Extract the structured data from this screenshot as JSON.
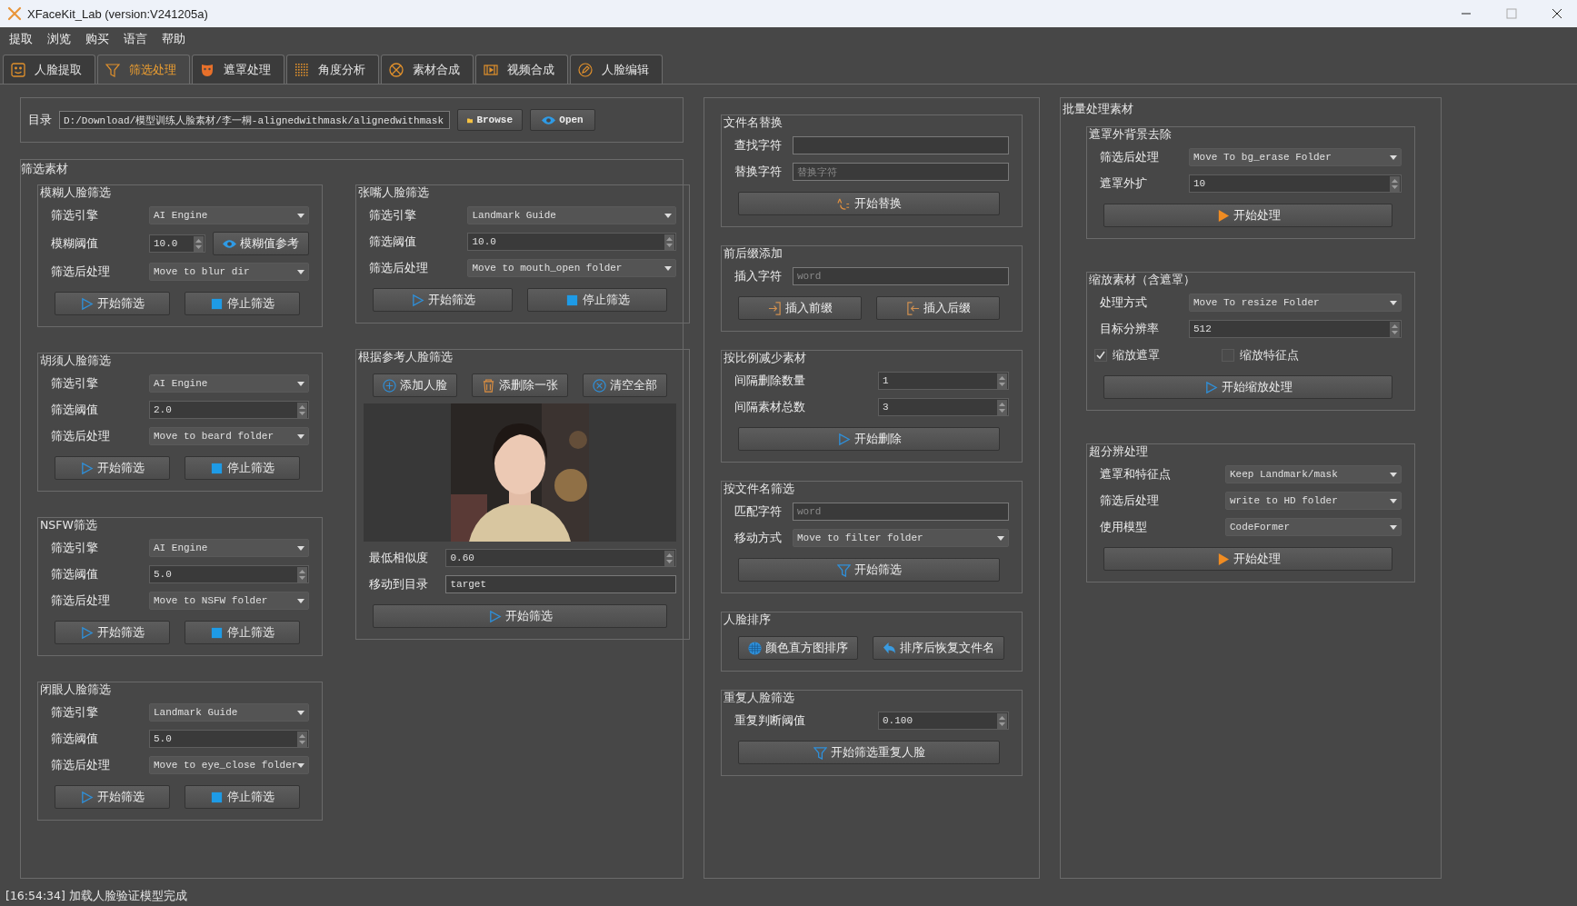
{
  "window": {
    "title": "XFaceKit_Lab (version:V241205a)"
  },
  "menu": [
    "提取",
    "浏览",
    "购买",
    "语言",
    "帮助"
  ],
  "tabs": [
    {
      "label": "人脸提取",
      "selected": false
    },
    {
      "label": "筛选处理",
      "selected": true
    },
    {
      "label": "遮罩处理",
      "selected": false
    },
    {
      "label": "角度分析",
      "selected": false
    },
    {
      "label": "素材合成",
      "selected": false
    },
    {
      "label": "视频合成",
      "selected": false
    },
    {
      "label": "人脸编辑",
      "selected": false
    }
  ],
  "directory": {
    "label": "目录",
    "value": "D:/Download/模型训练人脸素材/李一桐-alignedwithmask/alignedwithmask",
    "buttons": [
      {
        "label": "Browse",
        "kind": "folder"
      },
      {
        "label": "Open",
        "kind": "eye"
      }
    ]
  },
  "filter_panel": {
    "title": "筛选素材",
    "columns": [
      [
        {
          "title": "模糊人脸筛选",
          "rows": [
            {
              "kind": "combo",
              "label": "筛选引擎",
              "value": "AI Engine"
            },
            {
              "kind": "spin",
              "label": "模糊阈值",
              "value": "10.0",
              "button": {
                "label": "模糊值参考",
                "kind": "eye"
              }
            },
            {
              "kind": "combo",
              "label": "筛选后处理",
              "value": "Move to blur dir"
            },
            {
              "kind": "buttons",
              "buttons": [
                {
                  "label": "开始筛选",
                  "kind": "play"
                },
                {
                  "label": "停止筛选",
                  "kind": "stop"
                }
              ]
            }
          ]
        },
        {
          "title": "胡须人脸筛选",
          "rows": [
            {
              "kind": "combo",
              "label": "筛选引擎",
              "value": "AI Engine"
            },
            {
              "kind": "spin",
              "label": "筛选阈值",
              "value": "2.0"
            },
            {
              "kind": "combo",
              "label": "筛选后处理",
              "value": "Move to beard folder"
            },
            {
              "kind": "buttons",
              "buttons": [
                {
                  "label": "开始筛选",
                  "kind": "play"
                },
                {
                  "label": "停止筛选",
                  "kind": "stop"
                }
              ]
            }
          ]
        },
        {
          "title": "NSFW筛选",
          "rows": [
            {
              "kind": "combo",
              "label": "筛选引擎",
              "value": "AI Engine"
            },
            {
              "kind": "spin",
              "label": "筛选阈值",
              "value": "5.0"
            },
            {
              "kind": "combo",
              "label": "筛选后处理",
              "value": "Move to NSFW folder"
            },
            {
              "kind": "buttons",
              "buttons": [
                {
                  "label": "开始筛选",
                  "kind": "play"
                },
                {
                  "label": "停止筛选",
                  "kind": "stop"
                }
              ]
            }
          ]
        },
        {
          "title": "闭眼人脸筛选",
          "rows": [
            {
              "kind": "combo",
              "label": "筛选引擎",
              "value": "Landmark Guide"
            },
            {
              "kind": "spin",
              "label": "筛选阈值",
              "value": "5.0"
            },
            {
              "kind": "combo",
              "label": "筛选后处理",
              "value": "Move to eye_close folder"
            },
            {
              "kind": "buttons",
              "buttons": [
                {
                  "label": "开始筛选",
                  "kind": "play"
                },
                {
                  "label": "停止筛选",
                  "kind": "stop"
                }
              ]
            }
          ]
        }
      ],
      [
        {
          "title": "张嘴人脸筛选",
          "rows": [
            {
              "kind": "combo",
              "label": "筛选引擎",
              "value": "Landmark Guide"
            },
            {
              "kind": "spin",
              "label": "筛选阈值",
              "value": "10.0"
            },
            {
              "kind": "combo",
              "label": "筛选后处理",
              "value": "Move to mouth_open folder"
            },
            {
              "kind": "buttons",
              "buttons": [
                {
                  "label": "开始筛选",
                  "kind": "play"
                },
                {
                  "label": "停止筛选",
                  "kind": "stop"
                }
              ]
            }
          ]
        },
        {
          "title": "根据参考人脸筛选",
          "rows": [
            {
              "kind": "buttons",
              "buttons": [
                {
                  "label": "添加人脸",
                  "kind": "add"
                },
                {
                  "label": "添删除一张",
                  "kind": "trash"
                },
                {
                  "label": "清空全部",
                  "kind": "clear"
                }
              ]
            },
            {
              "kind": "picture"
            },
            {
              "kind": "spin",
              "label": "最低相似度",
              "value": "0.60"
            },
            {
              "kind": "input",
              "label": "移动到目录",
              "value": "target"
            },
            {
              "kind": "buttons",
              "buttons": [
                {
                  "label": "开始筛选",
                  "kind": "play"
                }
              ]
            }
          ]
        }
      ]
    ]
  },
  "tools_panel": {
    "groups": [
      {
        "title": "文件名替换",
        "rows": [
          {
            "kind": "input",
            "label": "查找字符"
          },
          {
            "kind": "input",
            "label": "替换字符",
            "placeholder": "替换字符"
          },
          {
            "kind": "buttons",
            "buttons": [
              {
                "label": "开始替换",
                "kind": "replace"
              }
            ]
          }
        ]
      },
      {
        "title": "前后缀添加",
        "rows": [
          {
            "kind": "input",
            "label": "插入字符",
            "placeholder": "word"
          },
          {
            "kind": "buttons",
            "buttons": [
              {
                "label": "插入前缀",
                "kind": "prefix"
              },
              {
                "label": "插入后缀",
                "kind": "suffix"
              }
            ]
          }
        ]
      },
      {
        "title": "按比例减少素材",
        "rows": [
          {
            "kind": "spin",
            "label": "间隔删除数量",
            "value": "1"
          },
          {
            "kind": "spin",
            "label": "间隔素材总数",
            "value": "3"
          },
          {
            "kind": "buttons",
            "buttons": [
              {
                "label": "开始删除",
                "kind": "play"
              }
            ]
          }
        ]
      },
      {
        "title": "按文件名筛选",
        "rows": [
          {
            "kind": "input",
            "label": "匹配字符",
            "placeholder": "word"
          },
          {
            "kind": "combo",
            "label": "移动方式",
            "value": "Move to filter folder"
          },
          {
            "kind": "buttons",
            "buttons": [
              {
                "label": "开始筛选",
                "kind": "filter"
              }
            ]
          }
        ]
      },
      {
        "title": "人脸排序",
        "rows": [
          {
            "kind": "buttons",
            "buttons": [
              {
                "label": "颜色直方图排序",
                "kind": "grid"
              },
              {
                "label": "排序后恢复文件名",
                "kind": "undo"
              }
            ]
          }
        ]
      },
      {
        "title": "重复人脸筛选",
        "rows": [
          {
            "kind": "spin",
            "label": "重复判断阈值",
            "value": "0.100"
          },
          {
            "kind": "buttons",
            "buttons": [
              {
                "label": "开始筛选重复人脸",
                "kind": "filter"
              }
            ]
          }
        ]
      }
    ]
  },
  "batch_panel": {
    "title": "批量处理素材",
    "groups": [
      {
        "title": "遮罩外背景去除",
        "rows": [
          {
            "kind": "combo",
            "label": "筛选后处理",
            "value": "Move To bg_erase Folder"
          },
          {
            "kind": "spin",
            "label": "遮罩外扩",
            "value": "10"
          },
          {
            "kind": "buttons",
            "buttons": [
              {
                "label": "开始处理",
                "kind": "run"
              }
            ]
          }
        ]
      },
      {
        "title": "缩放素材（含遮罩）",
        "rows": [
          {
            "kind": "combo",
            "label": "处理方式",
            "value": "Move To resize Folder"
          },
          {
            "kind": "spin",
            "label": "目标分辨率",
            "value": "512"
          },
          {
            "kind": "checks",
            "items": [
              {
                "label": "缩放遮罩",
                "checked": true
              },
              {
                "label": "缩放特征点",
                "checked": false
              }
            ]
          },
          {
            "kind": "buttons",
            "buttons": [
              {
                "label": "开始缩放处理",
                "kind": "play"
              }
            ]
          }
        ]
      },
      {
        "title": "超分辨处理",
        "rows": [
          {
            "kind": "combo",
            "label": "遮罩和特征点",
            "value": "Keep Landmark/mask"
          },
          {
            "kind": "combo",
            "label": "筛选后处理",
            "value": "write to HD folder"
          },
          {
            "kind": "combo",
            "label": "使用模型",
            "value": "CodeFormer"
          },
          {
            "kind": "buttons",
            "buttons": [
              {
                "label": "开始处理",
                "kind": "run"
              }
            ]
          }
        ]
      }
    ]
  },
  "status_bar": "[16:54:34] 加载人脸验证模型完成"
}
